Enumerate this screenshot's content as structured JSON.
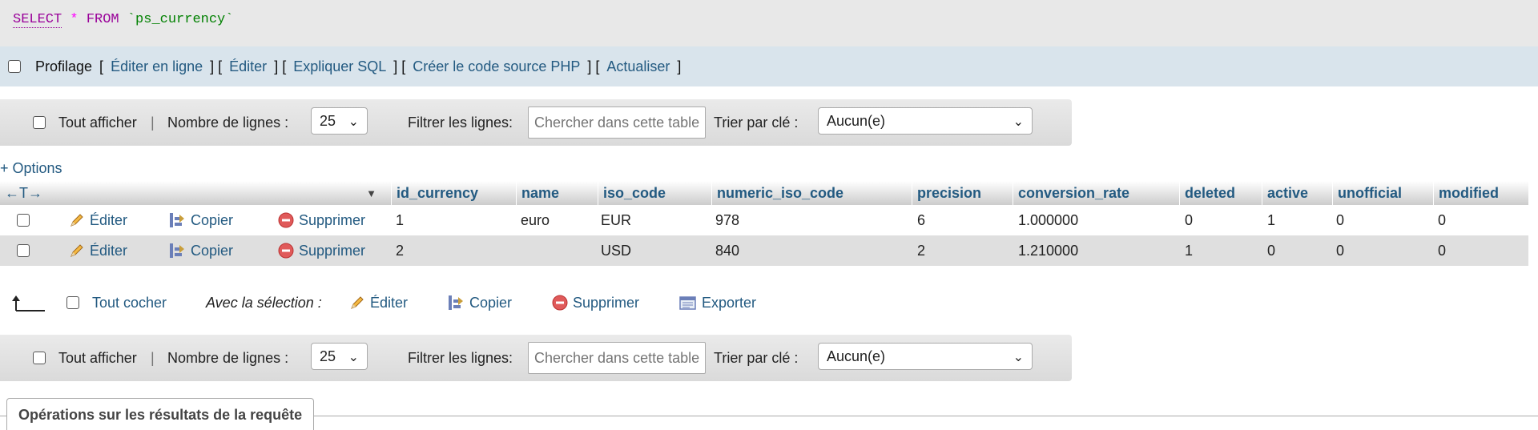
{
  "sql": {
    "kw_select": "SELECT",
    "star": "*",
    "kw_from": "FROM",
    "table": "`ps_currency`"
  },
  "profile": {
    "label": "Profilage",
    "links": [
      "Éditer en ligne",
      "Éditer",
      "Expliquer SQL",
      "Créer le code source PHP",
      "Actualiser"
    ]
  },
  "nav": {
    "show_all": "Tout afficher",
    "separator": "|",
    "rows_label": "Nombre de lignes :",
    "rows_value": "25",
    "filter_label": "Filtrer les lignes:",
    "filter_placeholder": "Chercher dans cette table",
    "sort_label": "Trier par clé :",
    "sort_value": "Aucun(e)"
  },
  "options_link": "+ Options",
  "table": {
    "arrows": "←T→",
    "columns": [
      "id_currency",
      "name",
      "iso_code",
      "numeric_iso_code",
      "precision",
      "conversion_rate",
      "deleted",
      "active",
      "unofficial",
      "modified"
    ],
    "actions": {
      "edit": "Éditer",
      "copy": "Copier",
      "delete": "Supprimer"
    },
    "rows": [
      [
        "1",
        "euro",
        "EUR",
        "978",
        "6",
        "1.000000",
        "0",
        "1",
        "0",
        "0"
      ],
      [
        "2",
        "",
        "USD",
        "840",
        "2",
        "1.210000",
        "1",
        "0",
        "0",
        "0"
      ]
    ]
  },
  "with_selection": {
    "check_all": "Tout cocher",
    "label": "Avec la sélection :",
    "edit": "Éditer",
    "copy": "Copier",
    "delete": "Supprimer",
    "export": "Exporter"
  },
  "operations_tab": "Opérations sur les résultats de la requête"
}
